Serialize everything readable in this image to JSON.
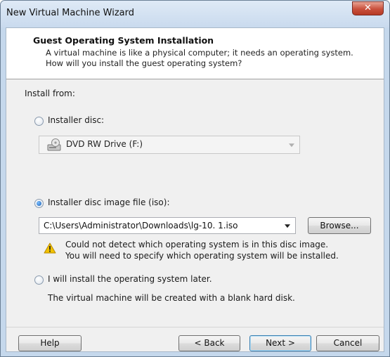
{
  "window": {
    "title": "New Virtual Machine Wizard",
    "close_glyph": "✕"
  },
  "header": {
    "title": "Guest Operating System Installation",
    "description": "A virtual machine is like a physical computer; it needs an operating system. How will you install the guest operating system?"
  },
  "install_from_label": "Install from:",
  "options": {
    "installer_disc": {
      "label": "Installer disc:",
      "selected": false,
      "drive": {
        "value": "DVD RW Drive (F:)",
        "icon": "dvd-drive-icon",
        "enabled": false
      }
    },
    "iso": {
      "label": "Installer disc image file (iso):",
      "selected": true,
      "path_value": "C:\\Users\\Administrator\\Downloads\\lg-10. 1.iso",
      "browse_label": "Browse...",
      "warning_icon": "warning-icon",
      "warning_line1": "Could not detect which operating system is in this disc image.",
      "warning_line2": "You will need to specify which operating system will be installed."
    },
    "later": {
      "label": "I will install the operating system later.",
      "selected": false,
      "note": "The virtual machine will be created with a blank hard disk."
    }
  },
  "footer": {
    "help_label": "Help",
    "back_label": "< Back",
    "next_label": "Next >",
    "cancel_label": "Cancel"
  },
  "colors": {
    "title_bar": "#c9daee",
    "close_button": "#c9503c",
    "client_bg": "#f0f0f0",
    "warning": "#f2c200"
  }
}
